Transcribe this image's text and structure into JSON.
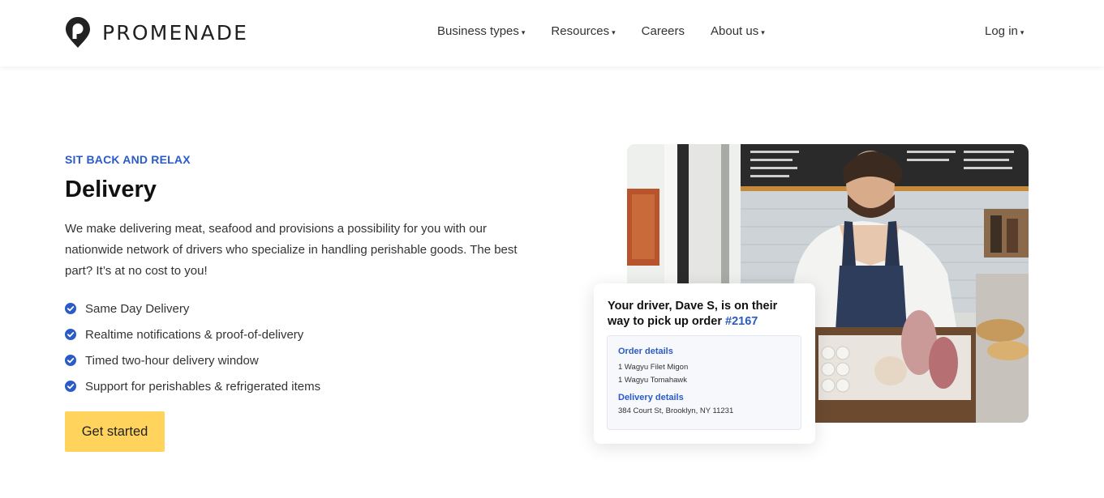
{
  "brand": {
    "name": "PROMENADE"
  },
  "nav": {
    "items": [
      {
        "label": "Business types",
        "dropdown": true
      },
      {
        "label": "Resources",
        "dropdown": true
      },
      {
        "label": "Careers",
        "dropdown": false
      },
      {
        "label": "About us",
        "dropdown": true
      }
    ],
    "login": "Log in"
  },
  "hero": {
    "eyebrow": "SIT BACK AND RELAX",
    "title": "Delivery",
    "description": "We make delivering meat, seafood and provisions a possibility for you with our nationwide network of drivers who specialize in handling perishable goods. The best part? It’s at no cost to you!",
    "features": [
      "Same Day Delivery",
      "Realtime notifications & proof-of-delivery",
      "Timed two-hour delivery window",
      "Support for perishables & refrigerated items"
    ],
    "cta": "Get started"
  },
  "card": {
    "title": "Your driver, Dave S, is on their way to pick up order",
    "order_number": "#2167",
    "order_details_label": "Order details",
    "order_items": [
      "1 Wagyu Filet Migon",
      "1 Wagyu Tomahawk"
    ],
    "delivery_details_label": "Delivery details",
    "address": "384 Court St, Brooklyn, NY 11231"
  },
  "colors": {
    "accent_blue": "#2a5bc7",
    "cta_yellow": "#ffd35c",
    "text_dark": "#111111"
  },
  "icons": {
    "logo": "map-pin-icon",
    "feature_bullet": "check-circle-icon",
    "dropdown": "caret-down-icon"
  }
}
